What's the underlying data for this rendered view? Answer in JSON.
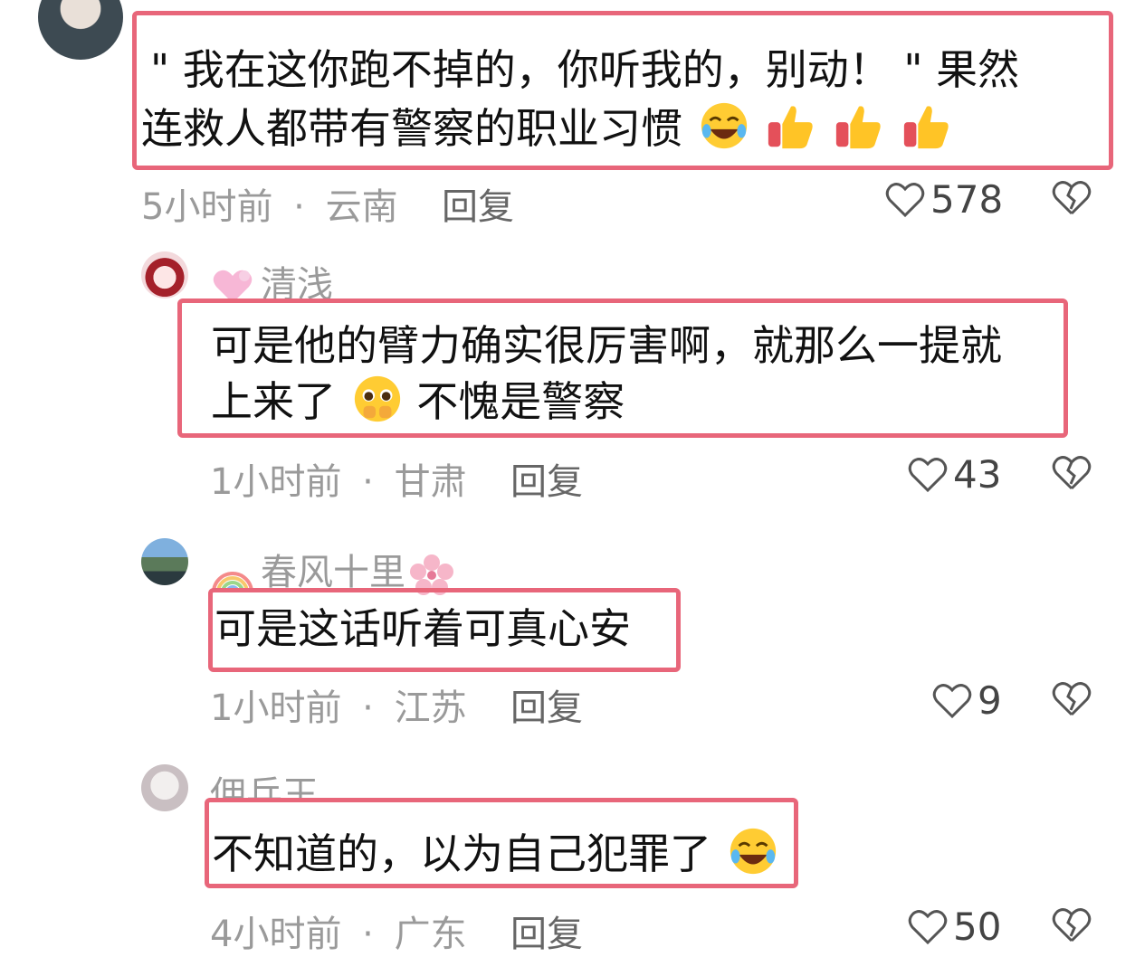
{
  "comments": [
    {
      "text_line1": "\" 我在这你跑不掉的，你听我的，别动！ \" 果然",
      "text_line2": "连救人都带有警察的职业习惯",
      "time": "5小时前",
      "location": "云南",
      "reply_label": "回复",
      "likes": "578",
      "emojis": [
        "laughing-crying-emoji",
        "thumbs-up-emoji",
        "thumbs-up-emoji",
        "thumbs-up-emoji"
      ]
    },
    {
      "username": "清浅",
      "username_badge": "pink-heart-icon",
      "text_line1": "可是他的臂力确实很厉害啊，就那么一提就",
      "text_line2": "上来了",
      "text_line2b": "不愧是警察",
      "time": "1小时前",
      "location": "甘肃",
      "reply_label": "回复",
      "likes": "43",
      "emojis": [
        "pleading-face-emoji"
      ]
    },
    {
      "username": "春风十里",
      "username_badge": "rainbow-icon",
      "username_suffix_icon": "cherry-blossom-icon",
      "text_line1": "可是这话听着可真心安",
      "time": "1小时前",
      "location": "江苏",
      "reply_label": "回复",
      "likes": "9"
    },
    {
      "username": "佣兵王",
      "text_line1": "不知道的，以为自己犯罪了",
      "time": "4小时前",
      "location": "广东",
      "reply_label": "回复",
      "likes": "50",
      "emojis": [
        "laughing-crying-emoji"
      ]
    }
  ],
  "separator": "·",
  "colors": {
    "highlight_border": "#e8667a",
    "meta_text": "#9a9a9a",
    "body_text": "#111111"
  }
}
